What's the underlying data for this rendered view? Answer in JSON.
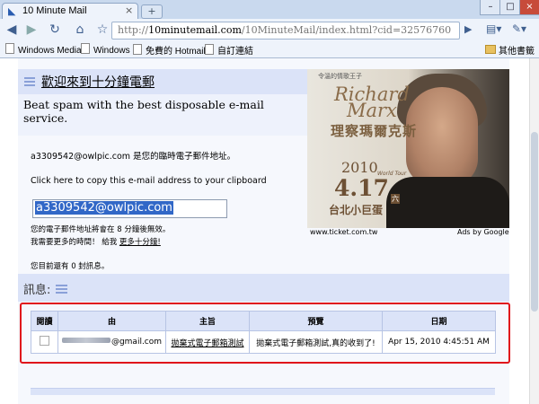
{
  "browser": {
    "tab_title": "10 Minute Mail",
    "tab_close": "×",
    "new_tab": "+",
    "window_buttons": {
      "minimize": "–",
      "maximize": "□",
      "close": "×"
    },
    "url_prefix": "http://",
    "url_host": "10minutemail.com",
    "url_path": "/10MinuteMail/index.html?cid=32576760",
    "bookmarks": [
      "Windows Media",
      "Windows",
      "免費的 Hotmail",
      "自訂連結"
    ],
    "other_bookmarks": "其他書籤",
    "icons": [
      "back-icon",
      "forward-icon",
      "reload-icon",
      "home-icon",
      "star-icon",
      "go-icon",
      "page-menu-icon",
      "tools-menu-icon"
    ]
  },
  "page": {
    "welcome_title": "歡迎來到十分鐘電郵",
    "tagline": "Beat spam with the best disposable e-mail service.",
    "address_line": "a3309542@owlpic.com 是您的臨時電子郵件地址。",
    "copy_link": "Click here to copy this e-mail address to your clipboard",
    "email_value": "a3309542@owlpic.com",
    "expire_text": "您的電子郵件地址將會在 8 分鐘後無效。",
    "more_time_prefix": "我需要更多的時間！ 給我 ",
    "more_time_link": "更多十分鐘!",
    "inbox_count": "您目前還有 0 封訊息。",
    "messages_title": "訊息:"
  },
  "ad": {
    "caption": "令溫的情歌王子",
    "name_en_1": "Richard",
    "name_en_2": "Marx",
    "name_zh": "理察瑪爾克斯",
    "year": "2010",
    "tour": "World Tour",
    "date": "4.17",
    "day": "六",
    "venue": "台北小巨蛋",
    "source": "www.ticket.com.tw",
    "label": "Ads by Google"
  },
  "inbox": {
    "columns": [
      "閱讀",
      "由",
      "主旨",
      "預覽",
      "日期"
    ],
    "rows": [
      {
        "sender": "@gmail.com",
        "subject": "拋棄式電子郵箱測試",
        "preview": "拋棄式電子郵箱測試,真的收到了!",
        "date": "Apr 15, 2010 4:45:51 AM"
      }
    ]
  },
  "colors": {
    "highlight": "#e0141b",
    "panel": "#dbe3f8",
    "selection": "#3167c7"
  }
}
